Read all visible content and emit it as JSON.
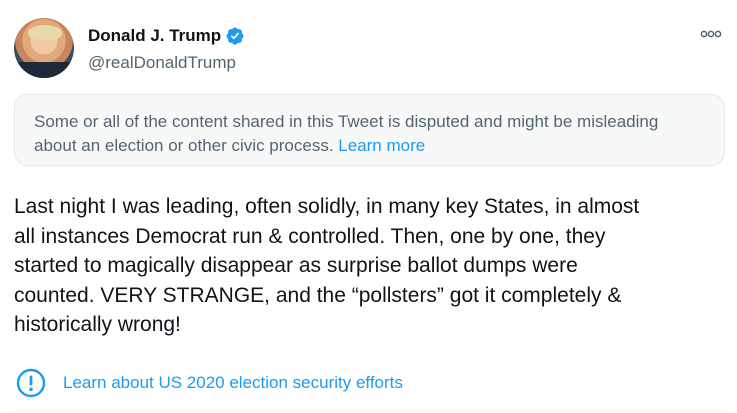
{
  "author": {
    "display_name": "Donald J. Trump",
    "handle": "@realDonaldTrump",
    "verified": true
  },
  "notice": {
    "text": "Some or all of the content shared in this Tweet is disputed and might be misleading about an election or other civic process.",
    "link_label": "Learn more"
  },
  "tweet": {
    "text": "Last night I was leading, often solidly, in many key States, in almost\nall instances Democrat run & controlled. Then, one by one, they\nstarted to magically disappear as surprise ballot dumps were\ncounted. VERY STRANGE, and the “pollsters” got it completely &\nhistorically wrong!"
  },
  "election_label": {
    "text": "Learn about US 2020 election security efforts",
    "icon": "exclamation-circle-icon"
  },
  "colors": {
    "accent": "#1d9bf0",
    "secondary_text": "#536471",
    "notice_background": "#f7f9f9"
  }
}
